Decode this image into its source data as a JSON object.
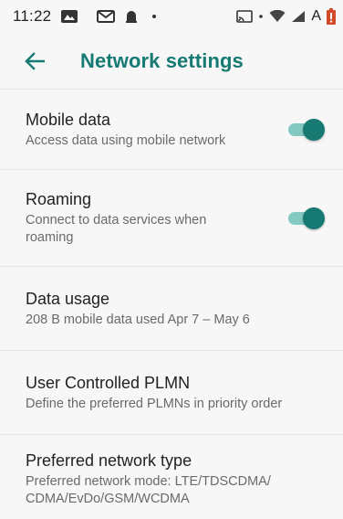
{
  "status_bar": {
    "time": "11:22",
    "right_text": "A",
    "icons": [
      "photos-icon",
      "gmail-icon",
      "notification-icon",
      "dot-icon",
      "cast-icon",
      "wifi-icon",
      "signal-icon",
      "battery-alert-icon"
    ]
  },
  "header": {
    "title": "Network settings",
    "back_icon": "arrow-left-icon"
  },
  "settings": [
    {
      "title": "Mobile data",
      "summary": "Access data using mobile network",
      "toggle": true
    },
    {
      "title": "Roaming",
      "summary": "Connect to data services when roaming",
      "toggle": true
    },
    {
      "title": "Data usage",
      "summary": "208 B mobile data used Apr 7 – May 6"
    },
    {
      "title": "User Controlled PLMN",
      "summary": "Define the preferred PLMNs in priority order"
    },
    {
      "title": "Preferred network type",
      "summary": "Preferred network mode: LTE/TDSCDMA/ CDMA/EvDo/GSM/WCDMA"
    }
  ],
  "colors": {
    "accent": "#167a73",
    "accent_light": "#84c9c1",
    "background": "#f7f7f7",
    "summary_text": "#6a6a6a"
  }
}
